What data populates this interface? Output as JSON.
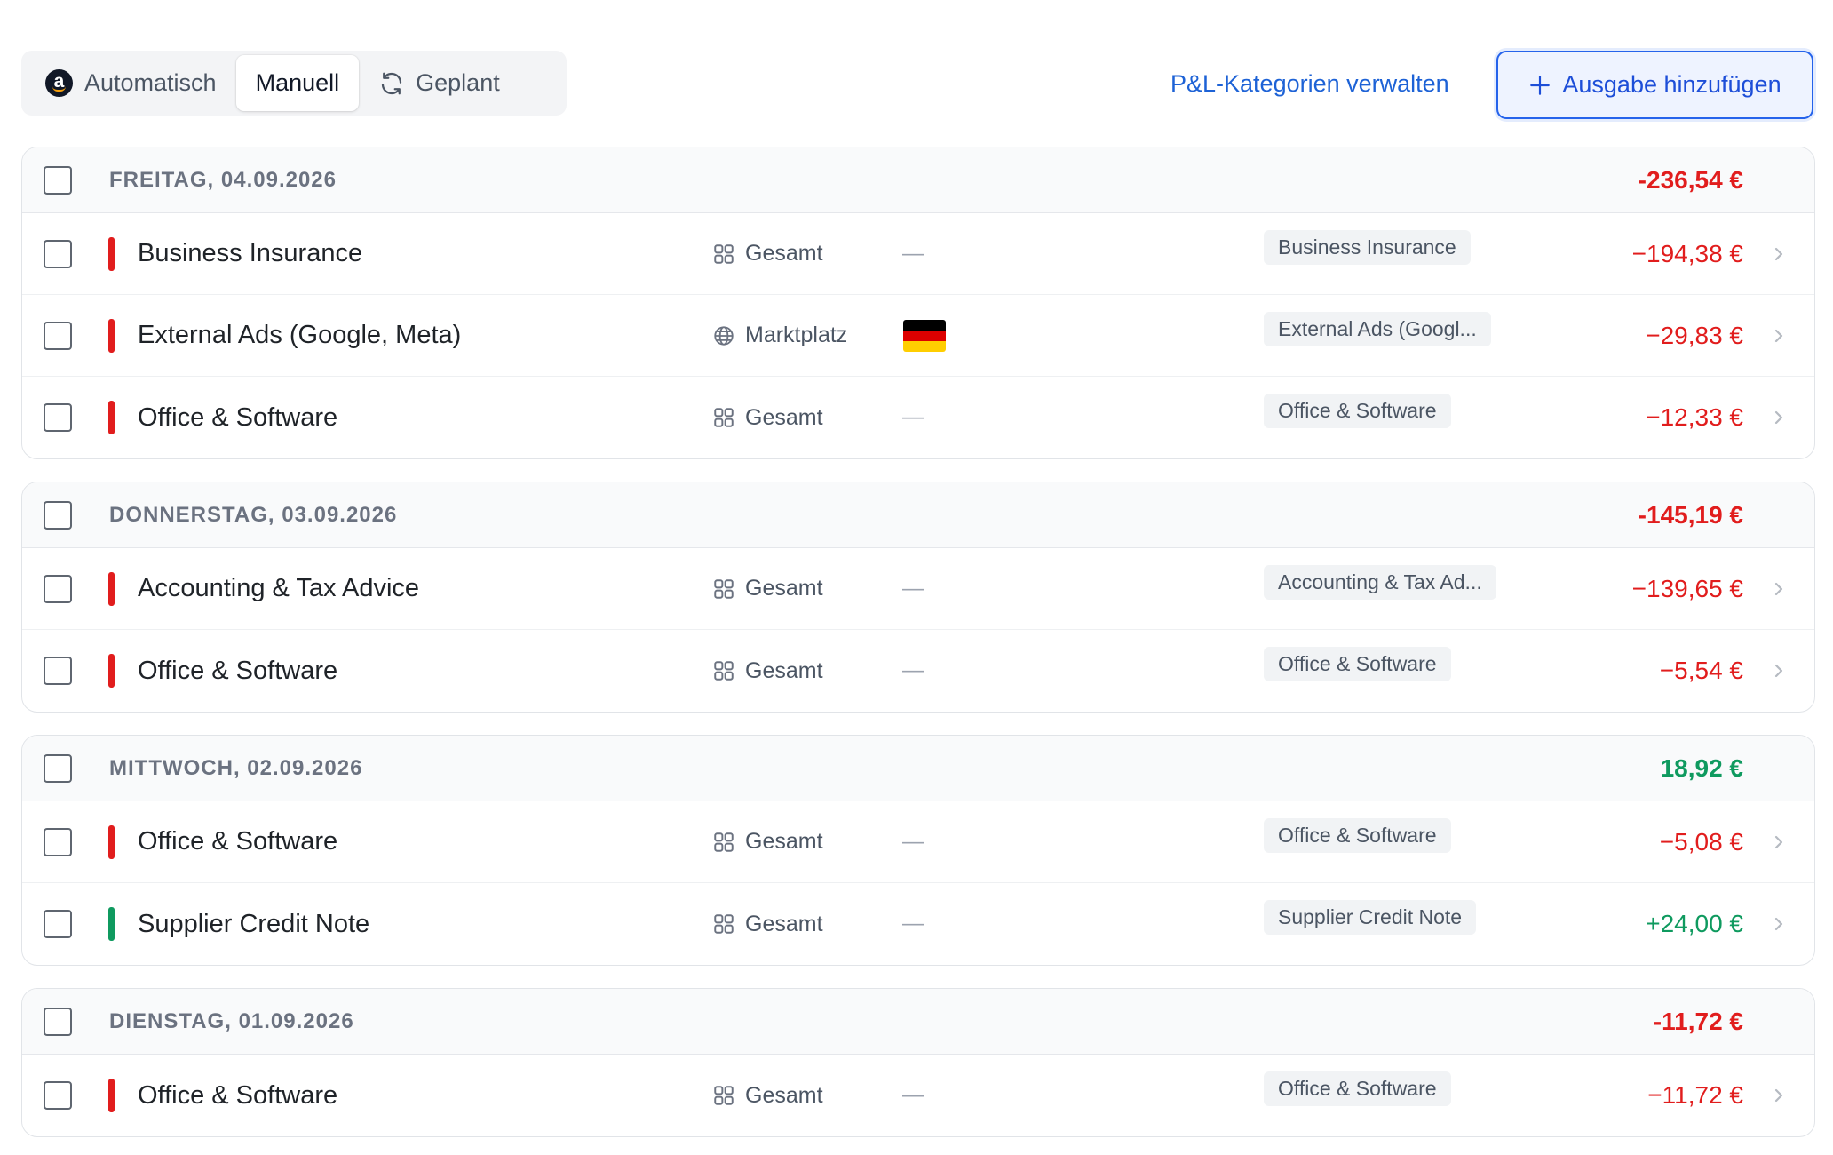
{
  "toolbar": {
    "tabs": [
      {
        "label": "Automatisch",
        "icon": "amazon-icon",
        "active": false
      },
      {
        "label": "Manuell",
        "icon": "",
        "active": true
      },
      {
        "label": "Geplant",
        "icon": "refresh-icon",
        "active": false
      }
    ],
    "manage_link": "P&L-Kategorien verwalten",
    "add_button": "Ausgabe hinzufügen"
  },
  "colors": {
    "negative": "#e11d1d",
    "positive": "#0f9a5f",
    "link": "#1d62d6"
  },
  "groups": [
    {
      "date": "FREITAG, 04.09.2026",
      "total": "-236,54 €",
      "total_sign": "neg",
      "rows": [
        {
          "name": "Business Insurance",
          "scope": "Gesamt",
          "scope_icon": "grid-icon",
          "marketplace": "—",
          "category": "Business Insurance",
          "amount": "−194,38 €",
          "sign": "neg"
        },
        {
          "name": "External Ads (Google, Meta)",
          "scope": "Marktplatz",
          "scope_icon": "globe-icon",
          "marketplace": "germany-flag",
          "category": "External Ads (Googl...",
          "amount": "−29,83 €",
          "sign": "neg"
        },
        {
          "name": "Office & Software",
          "scope": "Gesamt",
          "scope_icon": "grid-icon",
          "marketplace": "—",
          "category": "Office & Software",
          "amount": "−12,33 €",
          "sign": "neg"
        }
      ]
    },
    {
      "date": "DONNERSTAG, 03.09.2026",
      "total": "-145,19 €",
      "total_sign": "neg",
      "rows": [
        {
          "name": "Accounting & Tax Advice",
          "scope": "Gesamt",
          "scope_icon": "grid-icon",
          "marketplace": "—",
          "category": "Accounting & Tax Ad...",
          "amount": "−139,65 €",
          "sign": "neg"
        },
        {
          "name": "Office & Software",
          "scope": "Gesamt",
          "scope_icon": "grid-icon",
          "marketplace": "—",
          "category": "Office & Software",
          "amount": "−5,54 €",
          "sign": "neg"
        }
      ]
    },
    {
      "date": "MITTWOCH, 02.09.2026",
      "total": "18,92 €",
      "total_sign": "pos",
      "rows": [
        {
          "name": "Office & Software",
          "scope": "Gesamt",
          "scope_icon": "grid-icon",
          "marketplace": "—",
          "category": "Office & Software",
          "amount": "−5,08 €",
          "sign": "neg"
        },
        {
          "name": "Supplier Credit Note",
          "scope": "Gesamt",
          "scope_icon": "grid-icon",
          "marketplace": "—",
          "category": "Supplier Credit Note",
          "amount": "+24,00 €",
          "sign": "pos"
        }
      ]
    },
    {
      "date": "DIENSTAG, 01.09.2026",
      "total": "-11,72 €",
      "total_sign": "neg",
      "rows": [
        {
          "name": "Office & Software",
          "scope": "Gesamt",
          "scope_icon": "grid-icon",
          "marketplace": "—",
          "category": "Office & Software",
          "amount": "−11,72 €",
          "sign": "neg"
        }
      ]
    }
  ]
}
